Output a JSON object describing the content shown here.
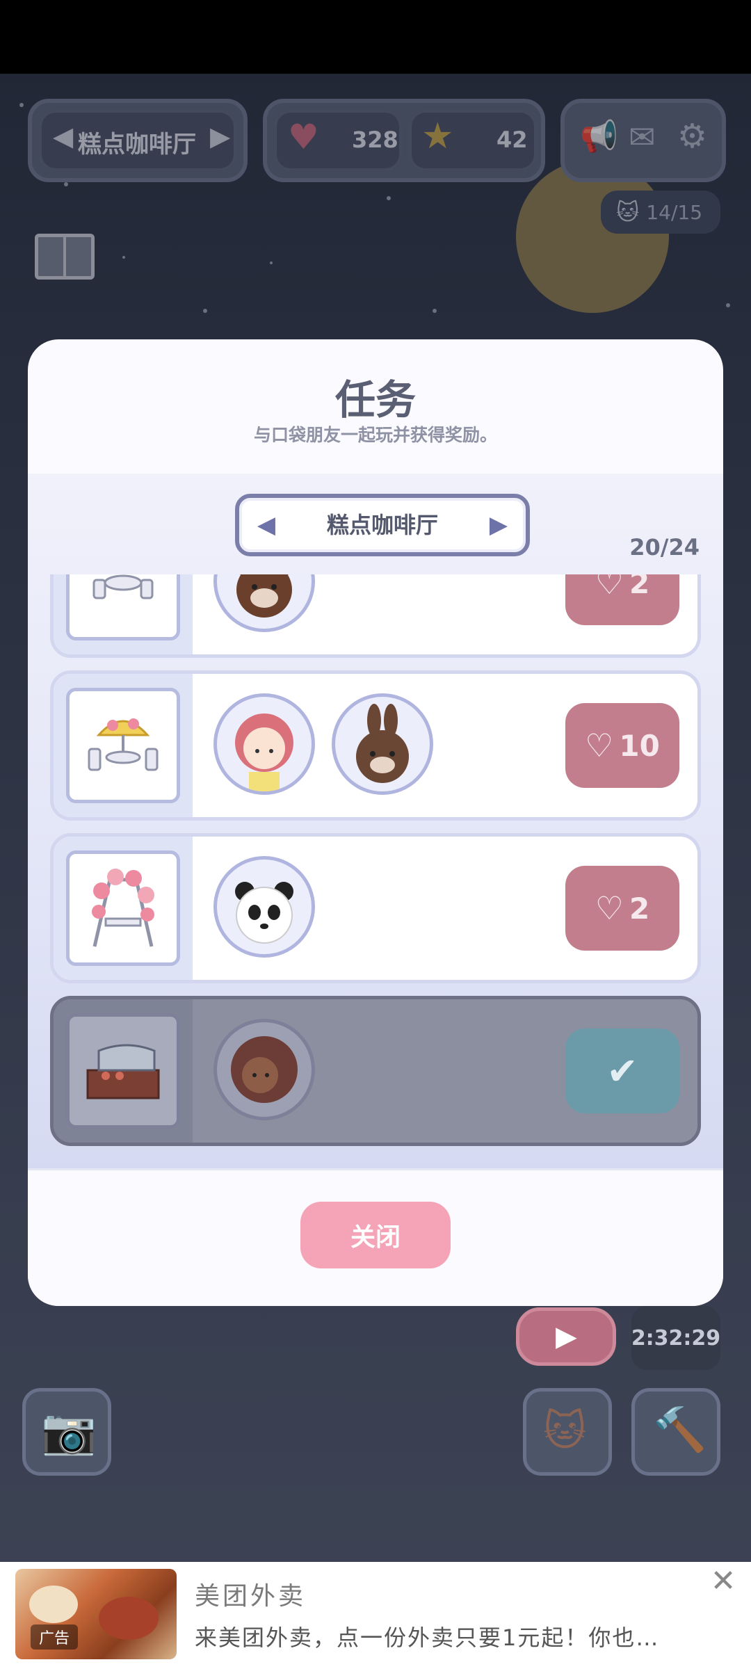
{
  "hud": {
    "location": "糕点咖啡厅",
    "hearts": "328",
    "stars": "42",
    "cat_count": "14/15"
  },
  "modal": {
    "title": "任务",
    "subtitle": "与口袋朋友一起玩并获得奖励。",
    "selector_label": "糕点咖啡厅",
    "progress": "20/24",
    "tasks": [
      {
        "reward": "2",
        "state": "available"
      },
      {
        "reward": "10",
        "state": "available"
      },
      {
        "reward": "2",
        "state": "available"
      },
      {
        "reward": "",
        "state": "completed"
      }
    ],
    "close_label": "关闭"
  },
  "timer": "2:32:29",
  "ad": {
    "tag": "广告",
    "title": "美团外卖",
    "description": "来美团外卖，点一份外卖只要1元起！你也…"
  },
  "colors": {
    "reward_pink": "#c27e8c",
    "completed_teal": "#6b9aa9",
    "close_button": "#f4a4b6"
  }
}
